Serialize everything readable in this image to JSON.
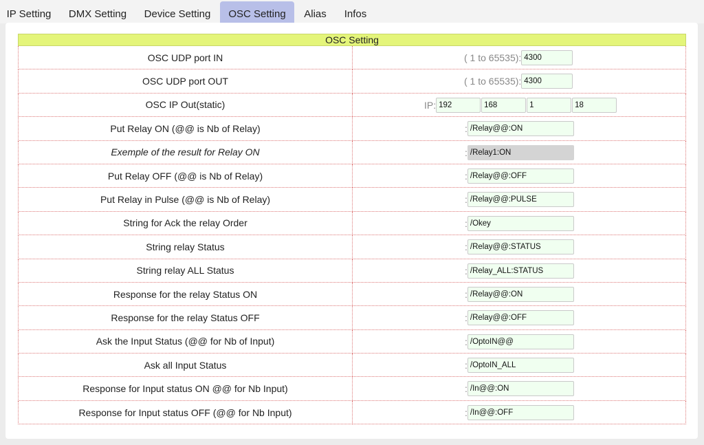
{
  "tabs": [
    {
      "label": "IP Setting",
      "active": false
    },
    {
      "label": "DMX Setting",
      "active": false
    },
    {
      "label": "Device Setting",
      "active": false
    },
    {
      "label": "OSC Setting",
      "active": true
    },
    {
      "label": "Alias",
      "active": false
    },
    {
      "label": "Infos",
      "active": false
    }
  ],
  "table": {
    "header": "OSC Setting",
    "port_hint": "( 1 to 65535):",
    "ip_prefix": "IP:",
    "field_prefix": ":",
    "port_in": {
      "label": "OSC UDP port IN",
      "value": "4300"
    },
    "port_out": {
      "label": "OSC UDP port OUT",
      "value": "4300"
    },
    "ip_out": {
      "label": "OSC IP Out(static)",
      "octets": [
        "192",
        "168",
        "1",
        "18"
      ]
    },
    "rows": [
      {
        "label": "Put Relay ON (@@ is Nb of Relay)",
        "value": "/Relay@@:ON"
      },
      {
        "label": "Exemple of the result for Relay ON",
        "value": "/Relay1:ON"
      },
      {
        "label": "Put Relay OFF (@@ is Nb of Relay)",
        "value": "/Relay@@:OFF"
      },
      {
        "label": "Put Relay in Pulse (@@ is Nb of Relay)",
        "value": "/Relay@@:PULSE"
      },
      {
        "label": "String for Ack the relay Order",
        "value": "/Okey"
      },
      {
        "label": "String relay Status",
        "value": "/Relay@@:STATUS"
      },
      {
        "label": "String relay ALL Status",
        "value": "/Relay_ALL:STATUS"
      },
      {
        "label": "Response for the relay Status ON",
        "value": "/Relay@@:ON"
      },
      {
        "label": "Response for the relay Status OFF",
        "value": "/Relay@@:OFF"
      },
      {
        "label": "Ask the Input Status (@@ for Nb of Input)",
        "value": "/OptoIN@@"
      },
      {
        "label": "Ask all Input Status",
        "value": "/OptoIN_ALL"
      },
      {
        "label": "Response for Input status ON @@ for Nb Input)",
        "value": "/In@@:ON"
      },
      {
        "label": "Response for Input status OFF (@@ for Nb Input)",
        "value": "/In@@:OFF"
      }
    ]
  },
  "colors": {
    "active_tab": "#b8bfe8",
    "header_bg": "#e4f57a",
    "input_bg": "#f0fff0",
    "readonly_bg": "#d4d4d4",
    "row_border": "#d77"
  }
}
